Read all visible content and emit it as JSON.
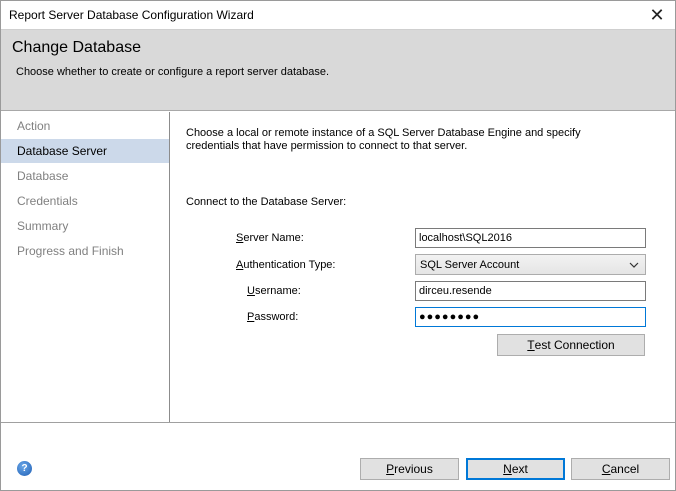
{
  "window": {
    "title": "Report Server Database Configuration Wizard",
    "close_glyph": "✕"
  },
  "header": {
    "title": "Change Database",
    "subtitle": "Choose whether to create or configure a report server database."
  },
  "nav": {
    "items": [
      {
        "label": "Action"
      },
      {
        "label": "Database Server"
      },
      {
        "label": "Database"
      },
      {
        "label": "Credentials"
      },
      {
        "label": "Summary"
      },
      {
        "label": "Progress and Finish"
      }
    ],
    "selected_index": 1
  },
  "content": {
    "description_line1": "Choose a local or remote instance of a SQL Server Database Engine and specify",
    "description_line2": "credentials that have permission to connect to that server.",
    "section_label": "Connect to the Database Server:",
    "server_name": {
      "label_first": "S",
      "label_rest": "erver Name:",
      "value": "localhost\\SQL2016"
    },
    "auth_type": {
      "label_first": "A",
      "label_rest": "uthentication Type:",
      "value": "SQL Server Account"
    },
    "username": {
      "label_first": "U",
      "label_rest": "sername:",
      "value": "dirceu.resende"
    },
    "password": {
      "label_first": "P",
      "label_rest": "assword:",
      "value": "●●●●●●●●"
    },
    "test_button": {
      "label_first": "T",
      "label_rest": "est Connection"
    }
  },
  "footer": {
    "help_icon": "help-icon",
    "previous_first": "P",
    "previous_rest": "revious",
    "next_first": "N",
    "next_rest": "ext",
    "cancel_first": "C",
    "cancel_rest": "ancel"
  },
  "colors": {
    "selected_nav_bg": "#ccd9ea",
    "header_bg": "#d9d9d9",
    "focus_border": "#0078d7"
  }
}
